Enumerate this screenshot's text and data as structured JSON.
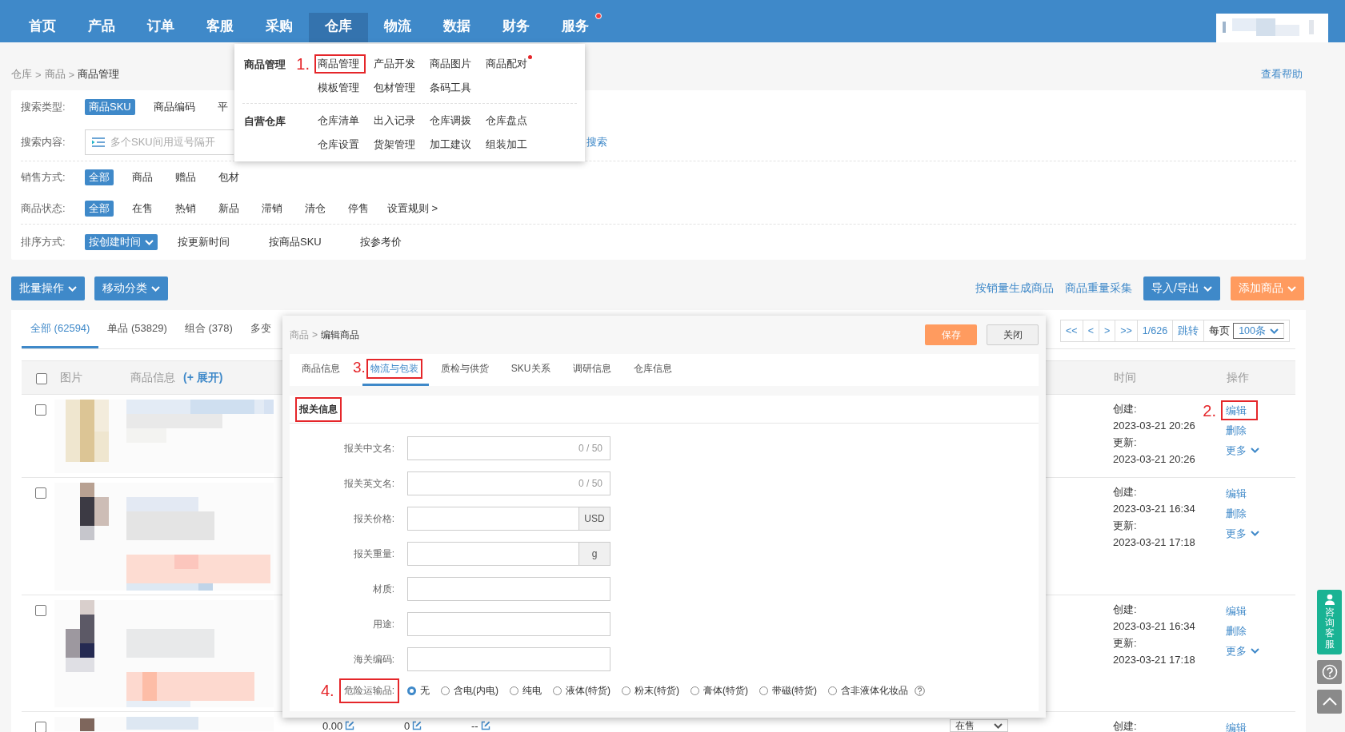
{
  "nav": {
    "items": [
      {
        "label": "首页",
        "selected": false,
        "badge": false
      },
      {
        "label": "产品",
        "selected": false,
        "badge": false
      },
      {
        "label": "订单",
        "selected": false,
        "badge": false
      },
      {
        "label": "客服",
        "selected": false,
        "badge": false
      },
      {
        "label": "采购",
        "selected": false,
        "badge": false
      },
      {
        "label": "仓库",
        "selected": true,
        "badge": false
      },
      {
        "label": "物流",
        "selected": false,
        "badge": false
      },
      {
        "label": "数据",
        "selected": false,
        "badge": false
      },
      {
        "label": "财务",
        "selected": false,
        "badge": false
      },
      {
        "label": "服务",
        "selected": false,
        "badge": true
      }
    ],
    "user_area": {
      "kind": "picture"
    }
  },
  "nav_menu": {
    "groups": [
      {
        "title": "商品管理",
        "items": [
          {
            "label": "商品管理",
            "annotation": "1.",
            "badge": false
          },
          {
            "label": "产品开发",
            "badge": false
          },
          {
            "label": "商品图片",
            "badge": false
          },
          {
            "label": "商品配对",
            "badge": true
          },
          {
            "label": "模板管理",
            "badge": false
          },
          {
            "label": "包材管理",
            "badge": false
          },
          {
            "label": "条码工具",
            "badge": false
          }
        ]
      },
      {
        "title": "自营仓库",
        "items": [
          {
            "label": "仓库清单",
            "badge": false
          },
          {
            "label": "出入记录",
            "badge": false
          },
          {
            "label": "仓库调拨",
            "badge": false
          },
          {
            "label": "仓库盘点",
            "badge": false
          },
          {
            "label": "仓库设置",
            "badge": false
          },
          {
            "label": "货架管理",
            "badge": false
          },
          {
            "label": "加工建议",
            "badge": false
          },
          {
            "label": "组装加工",
            "badge": false
          }
        ]
      }
    ]
  },
  "breadcrumb": [
    {
      "label": "仓库",
      "kind": "link"
    },
    {
      "label": ">",
      "kind": "separator"
    },
    {
      "label": "商品",
      "kind": "link"
    },
    {
      "label": ">",
      "kind": "separator"
    },
    {
      "label": "商品管理",
      "kind": "current"
    }
  ],
  "help_link": "查看帮助",
  "filters": [
    {
      "kind": "options",
      "label": "搜索类型:",
      "options": [
        {
          "label": "商品SKU",
          "selected": true
        },
        {
          "label": "商品编码",
          "selected": false
        },
        {
          "label": "平",
          "selected": false
        }
      ]
    },
    {
      "kind": "search",
      "label": "搜索内容:",
      "placeholder": "多个SKU间用逗号隔开",
      "button": "搜索"
    },
    {
      "kind": "options",
      "label": "销售方式:",
      "options": [
        {
          "label": "全部",
          "selected": true
        },
        {
          "label": "商品",
          "selected": false
        },
        {
          "label": "赠品",
          "selected": false
        },
        {
          "label": "包材",
          "selected": false
        }
      ]
    },
    {
      "kind": "options",
      "label": "商品状态:",
      "options": [
        {
          "label": "全部",
          "selected": true
        },
        {
          "label": "在售",
          "selected": false
        },
        {
          "label": "热销",
          "selected": false
        },
        {
          "label": "新品",
          "selected": false
        },
        {
          "label": "滞销",
          "selected": false
        },
        {
          "label": "清仓",
          "selected": false
        },
        {
          "label": "停售",
          "selected": false
        }
      ],
      "extra": "设置规则 >"
    },
    {
      "kind": "sort",
      "label": "排序方式:",
      "options": [
        {
          "label": "按创建时间",
          "selected": true
        },
        {
          "label": "按更新时间",
          "selected": false
        },
        {
          "label": "按商品SKU",
          "selected": false
        },
        {
          "label": "按参考价",
          "selected": false
        }
      ]
    }
  ],
  "toolbar": {
    "actions": [
      {
        "label": "批量操作"
      },
      {
        "label": "移动分类"
      }
    ],
    "links": [
      "按销量生成商品",
      "商品重量采集"
    ],
    "buttons": [
      {
        "label": "导入/导出",
        "kind": "primary"
      },
      {
        "label": "添加商品",
        "kind": "accent"
      }
    ]
  },
  "product_list": {
    "tabs": [
      {
        "label": "全部 (62594)",
        "selected": true
      },
      {
        "label": "单品 (53829)",
        "selected": false
      },
      {
        "label": "组合 (378)",
        "selected": false
      },
      {
        "label": "多变",
        "selected": false
      }
    ],
    "pagination": {
      "pages": [
        "<<",
        "<",
        ">",
        ">>",
        "1/626",
        "跳转"
      ],
      "per_page_label": "每页",
      "per_page": "100条"
    },
    "header": {
      "checked": false,
      "columns": [
        {
          "label": "图片"
        },
        {
          "label": "商品信息",
          "link": "(+ 展开)"
        }
      ],
      "time": "时间",
      "actions": "操作"
    },
    "rows": [
      {
        "checked": false,
        "image": {
          "kind": "picture"
        },
        "times": [
          "创建:",
          "2023-03-21 20:26",
          "更新:",
          "2023-03-21 20:26"
        ],
        "actions": [
          {
            "label": "编辑",
            "kind": "link",
            "annotation": "2."
          },
          {
            "label": "删除",
            "kind": "link"
          },
          {
            "label": "更多",
            "kind": "menu"
          }
        ]
      },
      {
        "checked": false,
        "image": {
          "kind": "picture"
        },
        "times": [
          "创建:",
          "2023-03-21 16:34",
          "更新:",
          "2023-03-21 17:18"
        ],
        "actions": [
          {
            "label": "编辑",
            "kind": "link"
          },
          {
            "label": "删除",
            "kind": "link"
          },
          {
            "label": "更多",
            "kind": "menu"
          }
        ]
      },
      {
        "checked": false,
        "image": {
          "kind": "picture"
        },
        "times": [
          "创建:",
          "2023-03-21 16:34",
          "更新:",
          "2023-03-21 17:18"
        ],
        "actions": [
          {
            "label": "编辑",
            "kind": "link"
          },
          {
            "label": "删除",
            "kind": "link"
          },
          {
            "label": "更多",
            "kind": "menu"
          }
        ]
      },
      {
        "checked": false,
        "image": {
          "kind": "picture"
        },
        "cells": [
          {
            "value": "0.00"
          },
          {
            "value": "0"
          },
          {
            "value": "--"
          }
        ],
        "status": "在售",
        "times": [
          "创建:"
        ],
        "actions": [
          {
            "label": "编辑",
            "kind": "link"
          }
        ]
      }
    ]
  },
  "edit_modal": {
    "breadcrumb": [
      {
        "label": "商品",
        "kind": "link"
      },
      {
        "label": ">",
        "kind": "separator"
      },
      {
        "label": "编辑商品",
        "kind": "current"
      }
    ],
    "buttons": [
      {
        "label": "保存",
        "kind": "accent"
      },
      {
        "label": "关闭",
        "kind": "default"
      }
    ],
    "tabs": [
      {
        "label": "商品信息",
        "selected": false
      },
      {
        "label": "物流与包装",
        "selected": true,
        "annotation": "3."
      },
      {
        "label": "质检与供货",
        "selected": false
      },
      {
        "label": "SKU关系",
        "selected": false
      },
      {
        "label": "调研信息",
        "selected": false
      },
      {
        "label": "仓库信息",
        "selected": false
      }
    ],
    "section": {
      "title": "报关信息",
      "highlighted": true,
      "fields": [
        {
          "label": "报关中文名:",
          "kind": "counter",
          "counter": "0 / 50"
        },
        {
          "label": "报关英文名:",
          "kind": "counter",
          "counter": "0 / 50"
        },
        {
          "label": "报关价格:",
          "kind": "addon",
          "addon": "USD"
        },
        {
          "label": "报关重量:",
          "kind": "addon",
          "addon": "g"
        },
        {
          "label": "材质:",
          "kind": "text"
        },
        {
          "label": "用途:",
          "kind": "text"
        },
        {
          "label": "海关编码:",
          "kind": "text"
        }
      ],
      "danger": {
        "label": "危险运输品:",
        "annotation": "4.",
        "options": [
          {
            "label": "无",
            "selected": true
          },
          {
            "label": "含电(内电)",
            "selected": false
          },
          {
            "label": "纯电",
            "selected": false
          },
          {
            "label": "液体(特货)",
            "selected": false
          },
          {
            "label": "粉末(特货)",
            "selected": false
          },
          {
            "label": "膏体(特货)",
            "selected": false
          },
          {
            "label": "带磁(特货)",
            "selected": false
          },
          {
            "label": "含非液体化妆品",
            "selected": false
          }
        ]
      }
    }
  },
  "side_tools": {
    "consult": "咨询客服"
  }
}
